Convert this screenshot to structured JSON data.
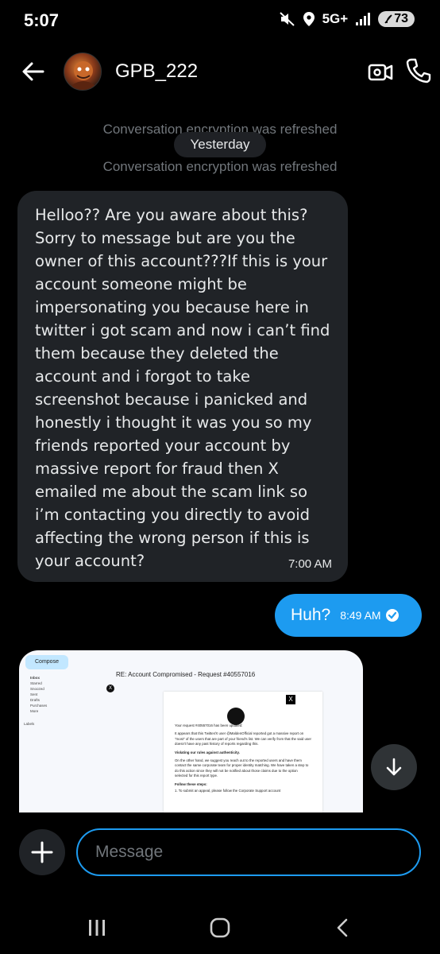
{
  "status_bar": {
    "time": "5:07",
    "network": "5G+",
    "battery": "73"
  },
  "header": {
    "contact_name": "GPB_222"
  },
  "system": {
    "encryption_notice_1": "Conversation encryption was refreshed",
    "date_chip": "Yesterday",
    "encryption_notice_2": "Conversation encryption was refreshed"
  },
  "messages": {
    "incoming": {
      "lines": [
        "Helloo?? Are you aware about this?",
        "Sorry to message but are you the",
        "owner of this account???If this is your",
        "account someone might be",
        "impersonating you because here in",
        "twitter i got scam and now i can’t find",
        "them because they deleted the",
        "account and i forgot to take",
        "screenshot because i panicked and",
        "honestly i thought it was you so my",
        "friends reported your account by",
        "massive report for fraud then X",
        "emailed me about the scam link so",
        "i’m contacting you directly to avoid",
        "affecting the wrong person if this is",
        "your account?"
      ],
      "time": "7:00 AM"
    },
    "outgoing": {
      "text": "Huh?",
      "time": "8:49 AM"
    }
  },
  "attachment": {
    "compose": "Compose",
    "sidebar": [
      "Inbox",
      "Starred",
      "Snoozed",
      "Sent",
      "Drafts",
      "Purchases",
      "More",
      "Labels"
    ],
    "subject": "RE: Account Compromised - Request #40557016",
    "body": {
      "line1": "Your request #40557016 has been updated:",
      "line2": "It appears that this Twitter/X user @MaldenOfficial reported got a massive report on \"most\" of the users that are part of your friend's list. We can verify from that the said user doesn't have any past history of reports regarding this.",
      "heading": "Violating our rules against authenticity.",
      "line3": "On the other hand, we suggest you reach out to the reported users and have them contact the same corporate team for proper identity matching. We have taken a step to do this action since they will not be notified about those claims due to the option selected for this report type.",
      "steps_heading": "Follow these steps:",
      "step1": "1. To submit an appeal, please follow the Corporate Support account"
    }
  },
  "composer": {
    "placeholder": "Message"
  },
  "colors": {
    "accent": "#1d9bf0",
    "bubble_in": "#202327",
    "background": "#000000",
    "muted": "#71767b"
  }
}
